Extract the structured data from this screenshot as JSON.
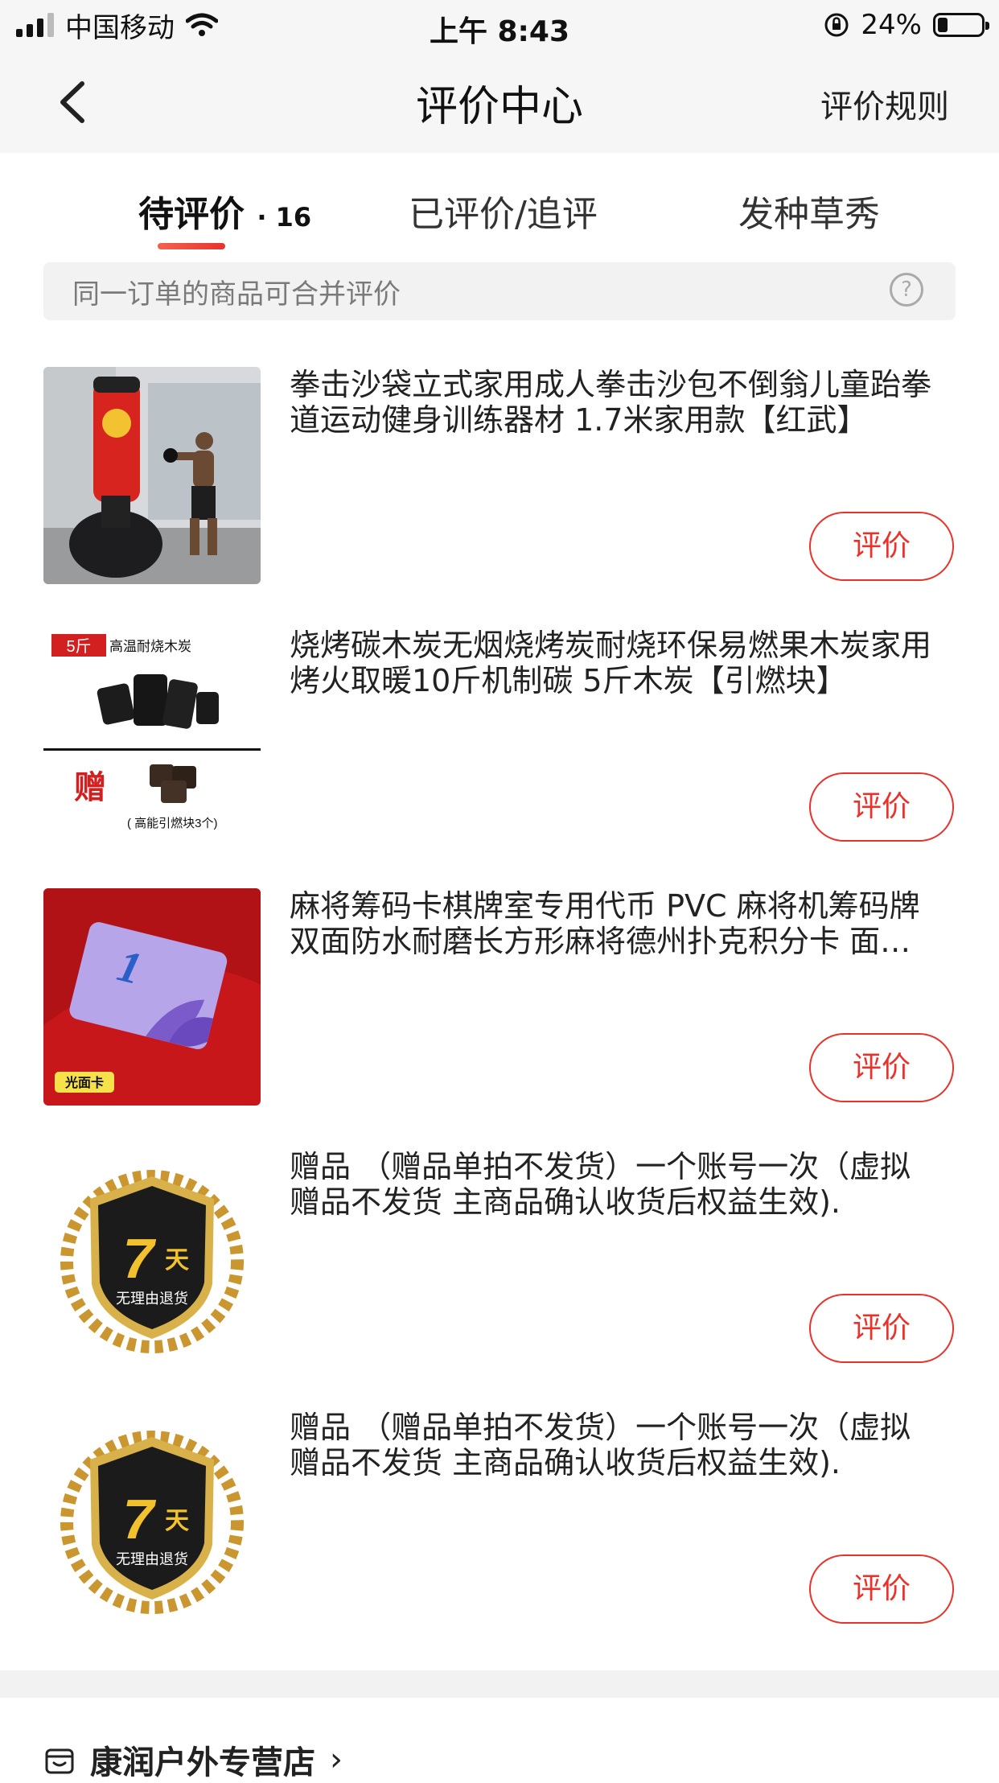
{
  "status_bar": {
    "carrier": "中国移动",
    "time": "上午 8:43",
    "battery": "24%",
    "battery_level": 0.24
  },
  "nav": {
    "title": "评价中心",
    "rules_label": "评价规则"
  },
  "tabs": [
    {
      "label": "待评价",
      "count": "· 16"
    },
    {
      "label": "已评价/追评"
    },
    {
      "label": "发种草秀"
    }
  ],
  "notice": {
    "text": "同一订单的商品可合并评价",
    "help_glyph": "?"
  },
  "items": [
    {
      "title": "拳击沙袋立式家用成人拳击沙包不倒翁儿童跆拳道运动健身训练器材 1.7米家用款【红武】",
      "button": "评价",
      "thumb": "punching-bag"
    },
    {
      "title": "烧烤碳木炭无烟烧烤炭耐烧环保易燃果木炭家用烤火取暖10斤机制碳 5斤木炭【引燃块】",
      "button": "评价",
      "thumb": "charcoal",
      "thumb_text": {
        "tag": "5斤",
        "caption": "高温耐烧木炭",
        "gift": "赠",
        "note": "( 高能引燃块3个)"
      }
    },
    {
      "title": "麻将筹码卡棋牌室专用代币 PVC 麻将机筹码牌双面防水耐磨长方形麻将德州扑克积分卡 面值版",
      "button": "评价",
      "thumb": "chip-card",
      "thumb_text": {
        "badge": "光面卡",
        "number": "1"
      }
    },
    {
      "title": "赠品 （赠品单拍不发货）一个账号一次（虚拟赠品不发货 主商品确认收货后权益生效).",
      "button": "评价",
      "thumb": "badge-7day",
      "thumb_text": {
        "big": "7",
        "unit": "天",
        "line": "无理由退货"
      }
    },
    {
      "title": "赠品 （赠品单拍不发货）一个账号一次（虚拟赠品不发货 主商品确认收货后权益生效).",
      "button": "评价",
      "thumb": "badge-7day",
      "thumb_text": {
        "big": "7",
        "unit": "天",
        "line": "无理由退货"
      }
    }
  ],
  "shop": {
    "name": "康润户外专营店",
    "chevron": "›"
  },
  "colors": {
    "accent": "#e8322b",
    "nav_bg": "#f6f6f6",
    "notice_bg": "#f2f2f2"
  }
}
